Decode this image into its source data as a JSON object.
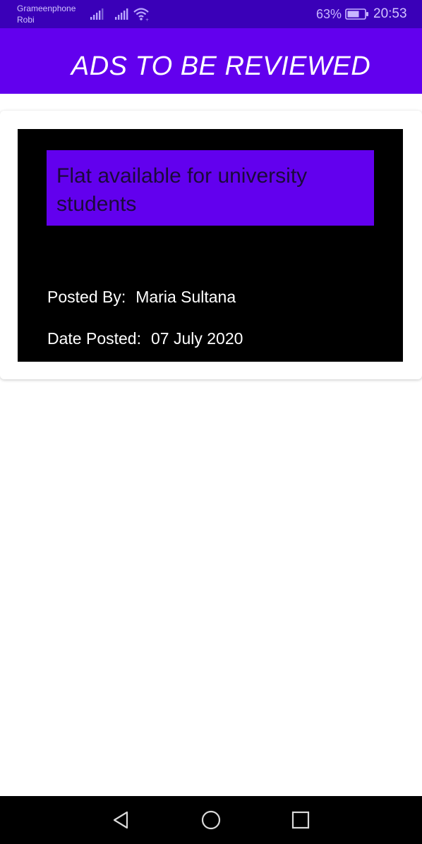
{
  "status_bar": {
    "carrier_1": "Grameenphone",
    "carrier_2": "Robi",
    "battery_percent": "63%",
    "time": "20:53",
    "icons": [
      "signal-icon",
      "signal-icon",
      "wifi-icon",
      "battery-icon"
    ]
  },
  "app_bar": {
    "title": "ADS TO BE REVIEWED",
    "color": "#6200ee"
  },
  "ads": [
    {
      "title": "Flat available for university students",
      "posted_by_label": "Posted By:",
      "posted_by": "Maria Sultana",
      "date_label": "Date Posted:",
      "date": "07 July 2020"
    }
  ],
  "nav_bar": {
    "icons": [
      "back-icon",
      "home-icon",
      "recents-icon"
    ]
  },
  "colors": {
    "status_bar": "#3a00b8",
    "accent": "#6200ee",
    "card_background": "#000000"
  }
}
